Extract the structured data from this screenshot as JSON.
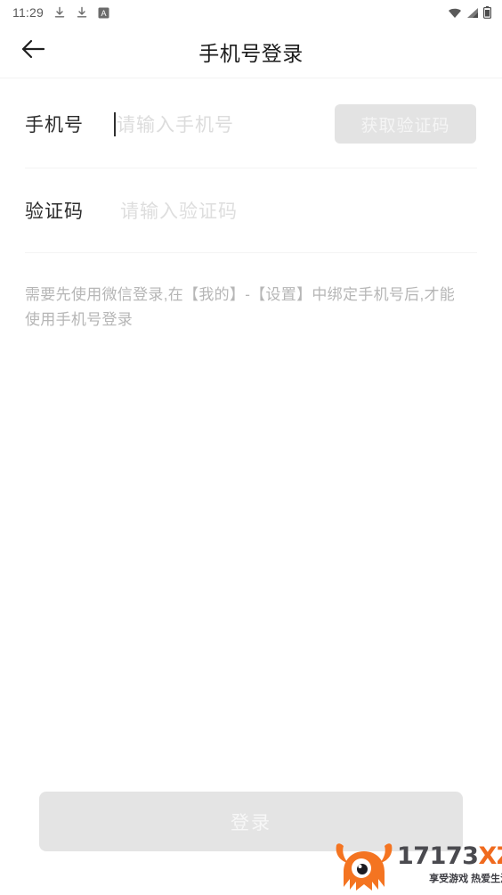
{
  "status_bar": {
    "clock": "11:29",
    "left_icons": [
      "download-icon",
      "download-icon",
      "letter-a-badge-icon"
    ],
    "right_icons": [
      "wifi-icon",
      "signal-icon",
      "battery-icon"
    ]
  },
  "header": {
    "back_icon": "arrow-left-icon",
    "title": "手机号登录"
  },
  "form": {
    "phone": {
      "label": "手机号",
      "value": "",
      "placeholder": "请输入手机号",
      "caret_visible": true,
      "action_button": {
        "label": "获取验证码",
        "enabled": false,
        "bg_color": "#e3e3e3",
        "text_color": "#f5f5f5"
      }
    },
    "code": {
      "label": "验证码",
      "value": "",
      "placeholder": "请输入验证码"
    }
  },
  "hint": "需要先使用微信登录,在【我的】-【设置】中绑定手机号后,才能使用手机号登录",
  "submit": {
    "label": "登录",
    "enabled": false,
    "bg_color": "#e4e4e4",
    "text_color": "#f7f7f7"
  },
  "watermark": {
    "logo_icon": "monster-mascot-icon",
    "brand_number": "17173",
    "brand_suffix": "XZ",
    "tagline": "享受游戏 热爱生活!",
    "accent_color": "#f06a1e",
    "dark_color": "#4a4a4f"
  }
}
